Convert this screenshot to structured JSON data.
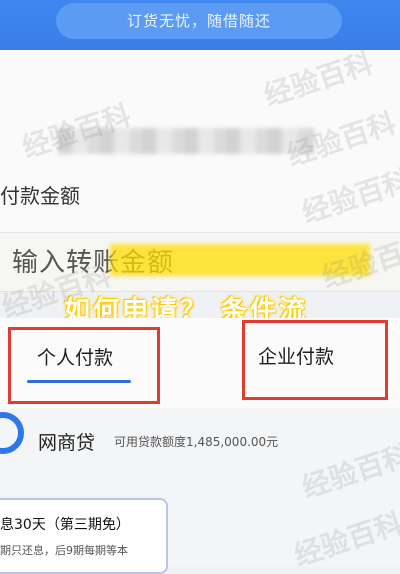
{
  "banner": {
    "text": "订货无忧，随借随还"
  },
  "payment": {
    "amount_label": "付款金额",
    "input_placeholder": "输入转账金额"
  },
  "overlay": {
    "title": "如何申请？ 条件流"
  },
  "tabs": [
    {
      "label": "个人付款",
      "selected": true
    },
    {
      "label": "企业付款",
      "selected": false
    }
  ],
  "loan": {
    "name": "网商贷",
    "limit_text": "可用贷款额度1,485,000.00元",
    "promo": "息30天（第三期免）",
    "terms": "期只还息，后9期每期等本"
  },
  "watermark": {
    "text": "经验百科"
  },
  "colors": {
    "brand_blue": "#3f86ef",
    "highlight_red": "#e33b2f",
    "overlay_yellow": "#ffd400"
  }
}
